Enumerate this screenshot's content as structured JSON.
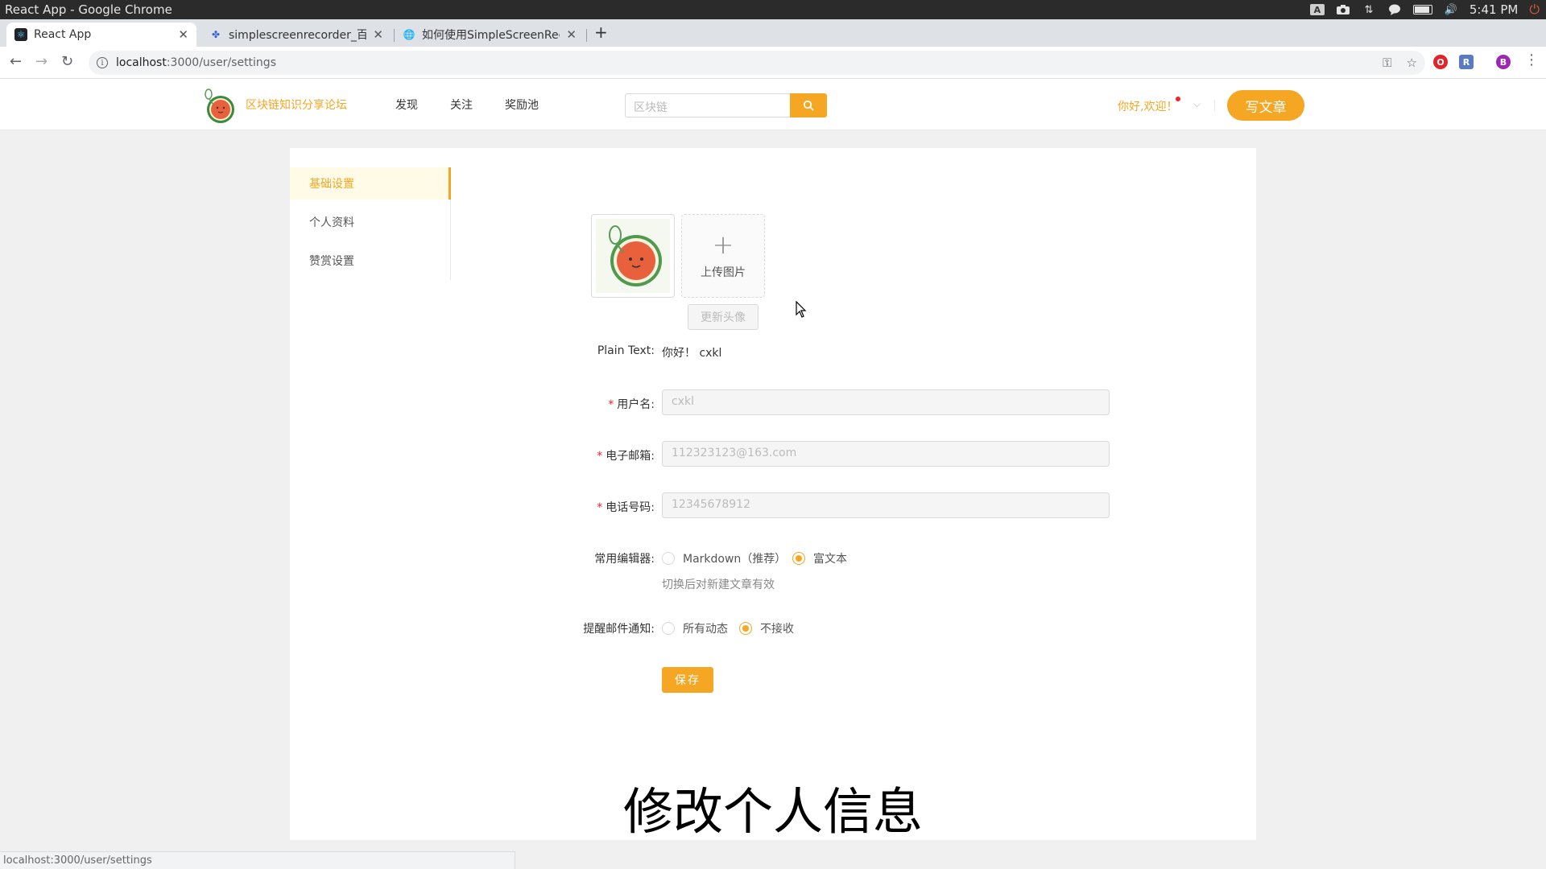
{
  "os": {
    "window_title": "React App - Google Chrome",
    "time": "5:41 PM"
  },
  "browser": {
    "tabs": [
      {
        "title": "React App",
        "active": true
      },
      {
        "title": "simplescreenrecorder_百度",
        "active": false
      },
      {
        "title": "如何使用SimpleScreenRec",
        "active": false
      }
    ],
    "url_host": "localhost",
    "url_path": ":3000/user/settings",
    "profile_initial": "B",
    "status_url": "localhost:3000/user/settings"
  },
  "header": {
    "site_name": "区块链知识分享论坛",
    "nav": [
      "发现",
      "关注",
      "奖励池"
    ],
    "search_placeholder": "区块链",
    "greeting": "你好,欢迎！",
    "write_label": "写文章"
  },
  "sidebar": {
    "items": [
      {
        "label": "基础设置",
        "active": true
      },
      {
        "label": "个人资料",
        "active": false
      },
      {
        "label": "赞赏设置",
        "active": false
      }
    ]
  },
  "avatar": {
    "upload_label": "上传图片",
    "update_label": "更新头像"
  },
  "form": {
    "plain_text_label": "Plain Text",
    "plain_text_value": "你好！ cxkl",
    "username_label": "用户名",
    "username_value": "cxkl",
    "email_label": "电子邮箱",
    "email_value": "112323123@163.com",
    "phone_label": "电话号码",
    "phone_value": "12345678912",
    "editor_label": "常用编辑器",
    "editor_options": [
      "Markdown（推荐）",
      "富文本"
    ],
    "editor_selected": "富文本",
    "editor_help": "切换后对新建文章有效",
    "notify_label": "提醒邮件通知",
    "notify_options": [
      "所有动态",
      "不接收"
    ],
    "notify_selected": "不接收",
    "save_label": "保存"
  },
  "caption": "修改个人信息",
  "colors": {
    "accent": "#f5a623",
    "required": "#f5222d"
  }
}
